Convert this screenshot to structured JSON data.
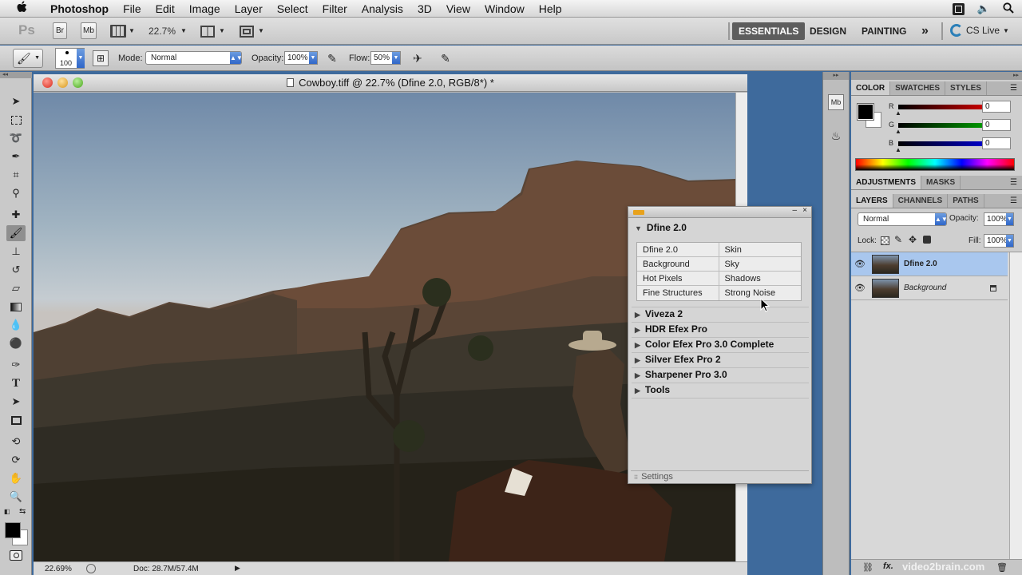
{
  "menubar": {
    "apple": "",
    "items": [
      "Photoshop",
      "File",
      "Edit",
      "Image",
      "Layer",
      "Select",
      "Filter",
      "Analysis",
      "3D",
      "View",
      "Window",
      "Help"
    ]
  },
  "appbar": {
    "ps_logo": "Ps",
    "br": "Br",
    "mb": "Mb",
    "zoom": "22.7%",
    "workspaces": [
      "ESSENTIALS",
      "DESIGN",
      "PAINTING"
    ],
    "overflow": "»",
    "cslive": "CS Live"
  },
  "options": {
    "brush_size": "100",
    "mode_label": "Mode:",
    "mode_value": "Normal",
    "opacity_label": "Opacity:",
    "opacity_value": "100%",
    "flow_label": "Flow:",
    "flow_value": "50%"
  },
  "document": {
    "title": "Cowboy.tiff @ 22.7% (Dfine 2.0, RGB/8*) *",
    "zoom": "22.69%",
    "doc_size": "Doc: 28.7M/57.4M"
  },
  "dfine": {
    "header": "Dfine 2.0",
    "grid": [
      [
        "Dfine 2.0",
        "Skin"
      ],
      [
        "Background",
        "Sky"
      ],
      [
        "Hot Pixels",
        "Shadows"
      ],
      [
        "Fine Structures",
        "Strong Noise"
      ]
    ],
    "sections": [
      "Viveza 2",
      "HDR Efex Pro",
      "Color Efex Pro 3.0 Complete",
      "Silver Efex Pro 2",
      "Sharpener Pro 3.0",
      "Tools"
    ],
    "settings": "Settings"
  },
  "color_panel": {
    "tabs": [
      "COLOR",
      "SWATCHES",
      "STYLES"
    ],
    "channels": [
      {
        "label": "R",
        "value": "0",
        "color": "#ff0000"
      },
      {
        "label": "G",
        "value": "0",
        "color": "#00c000"
      },
      {
        "label": "B",
        "value": "0",
        "color": "#0000ff"
      }
    ]
  },
  "adjustments_panel": {
    "tabs": [
      "ADJUSTMENTS",
      "MASKS"
    ]
  },
  "layers_panel": {
    "tabs": [
      "LAYERS",
      "CHANNELS",
      "PATHS"
    ],
    "blend_mode": "Normal",
    "opacity_label": "Opacity:",
    "opacity_value": "100%",
    "lock_label": "Lock:",
    "fill_label": "Fill:",
    "fill_value": "100%",
    "layers": [
      {
        "name": "Dfine 2.0",
        "selected": true
      },
      {
        "name": "Background",
        "selected": false
      }
    ]
  },
  "watermark": "video2brain.com",
  "colors": {
    "accent": "#2f66c9",
    "desktop": "#3e6a9c",
    "selection": "#a9c7ee"
  }
}
